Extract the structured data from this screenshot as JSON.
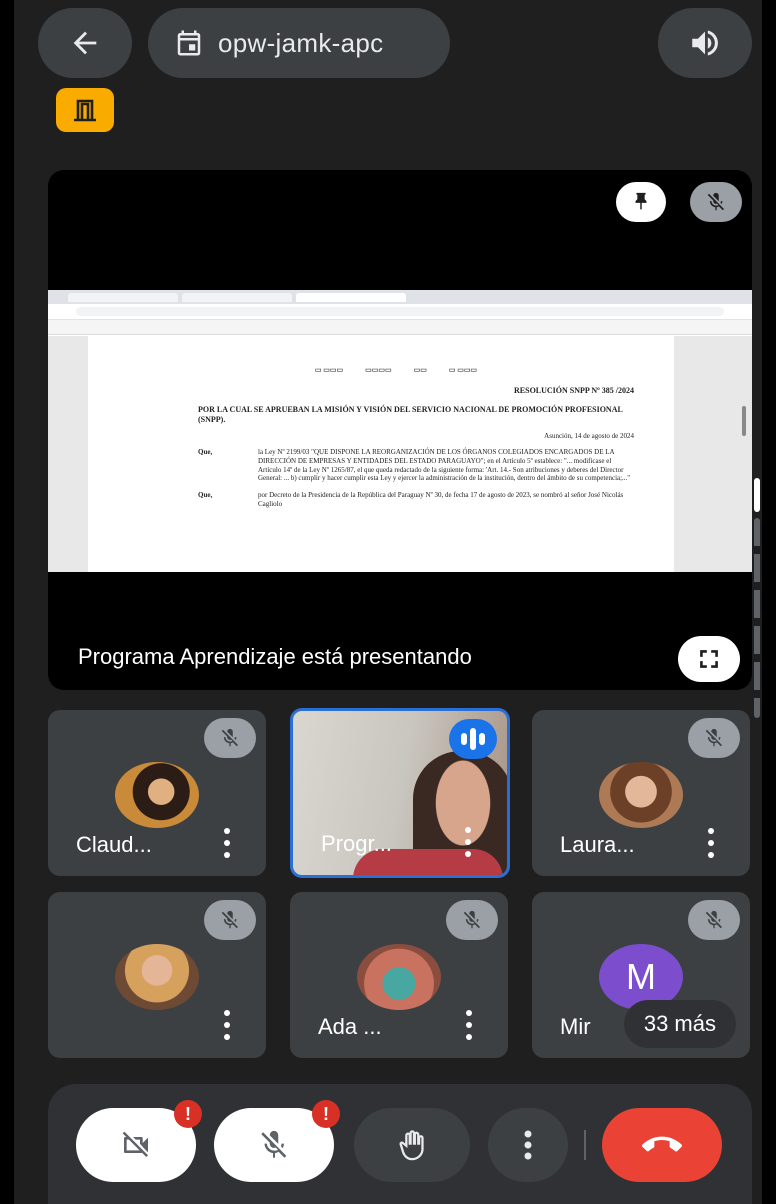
{
  "header": {
    "meeting_code": "opw-jamk-apc",
    "icons": {
      "back": "arrow-left-icon",
      "calendar": "calendar-icon",
      "speaker": "speaker-icon",
      "door": "door-icon"
    }
  },
  "presentation": {
    "status_text": "Programa Aprendizaje está presentando",
    "shared_document": {
      "resolution_label": "RESOLUCIÓN SNPP Nº 385 /2024",
      "title": "POR LA CUAL SE APRUEBAN LA MISIÓN Y VISIÓN DEL SERVICIO NACIONAL DE PROMOCIÓN PROFESIONAL (SNPP).",
      "date": "Asunción, 14 de agosto de 2024",
      "paragraphs": [
        {
          "label": "Que,",
          "text": "la Ley Nº 2199/03 \"QUE DISPONE LA REORGANIZACIÓN DE LOS ÓRGANOS COLEGIADOS ENCARGADOS DE LA DIRECCIÓN DE EMPRESAS Y ENTIDADES DEL ESTADO PARAGUAYO\"; en el Artículo 5º establece: \"... modificase el Artículo 14º de la Ley Nº 1265/87, el que queda redactado de la siguiente forma: 'Art. 14.- Son atribuciones y deberes del Director General: ... b) cumplir y hacer cumplir esta Ley y ejercer la administración de la institución, dentro del ámbito de su competencia;...\""
        },
        {
          "label": "Que,",
          "text": "por Decreto de la Presidencia de la República del Paraguay Nº 30, de fecha 17 de agosto de 2023, se nombró al señor José Nicolás Cagliolo"
        }
      ]
    }
  },
  "participants": [
    {
      "name": "Claud...",
      "muted": true,
      "avatar": "photo"
    },
    {
      "name": "Progr...",
      "muted": false,
      "speaking": true,
      "avatar": "video"
    },
    {
      "name": "Laura...",
      "muted": true,
      "avatar": "photo"
    },
    {
      "name": "",
      "muted": true,
      "avatar": "photo"
    },
    {
      "name": "Ada ...",
      "muted": true,
      "avatar": "photo"
    },
    {
      "name": "Mir",
      "muted": true,
      "avatar": "initial",
      "initial": "M"
    }
  ],
  "more_participants": "33 más",
  "controls": {
    "camera_alert": "!",
    "mic_alert": "!"
  },
  "colors": {
    "background": "#1f1f1f",
    "tile": "#3c4043",
    "end_call": "#ea4335",
    "accent_blue": "#1a73e8",
    "badge_yellow": "#f9ab00",
    "avatar_purple": "#7c4dcc"
  }
}
